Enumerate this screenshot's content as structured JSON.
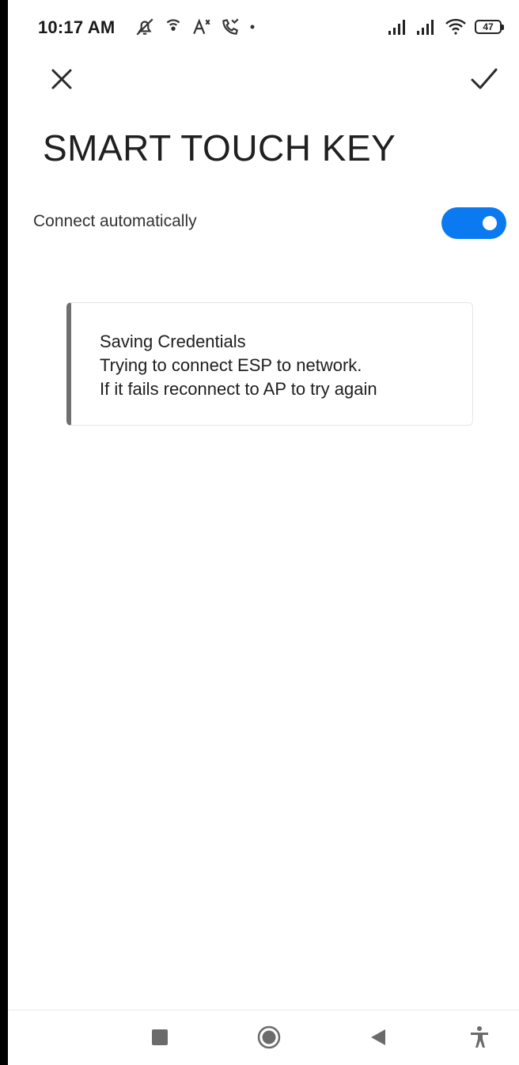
{
  "status_bar": {
    "time": "10:17 AM",
    "battery_level": "47",
    "left_icons": [
      "mute-icon",
      "hotspot-icon",
      "font-size-icon",
      "missed-call-icon",
      "dot-icon"
    ],
    "right_icons": [
      "signal-icon",
      "signal-icon",
      "wifi-icon",
      "battery-icon"
    ]
  },
  "header": {
    "close_icon": "close-icon",
    "confirm_icon": "check-icon",
    "title": "SMART TOUCH KEY"
  },
  "settings": {
    "connect_auto_label": "Connect automatically",
    "connect_auto_on": true,
    "toggle_color": "#0b7af0"
  },
  "message": {
    "lines": [
      "Saving Credentials",
      "Trying to connect ESP to network.",
      "If it fails reconnect to AP to try again"
    ]
  },
  "nav_bar": {
    "buttons": [
      "recents-icon",
      "home-icon",
      "back-icon",
      "accessibility-icon"
    ]
  }
}
